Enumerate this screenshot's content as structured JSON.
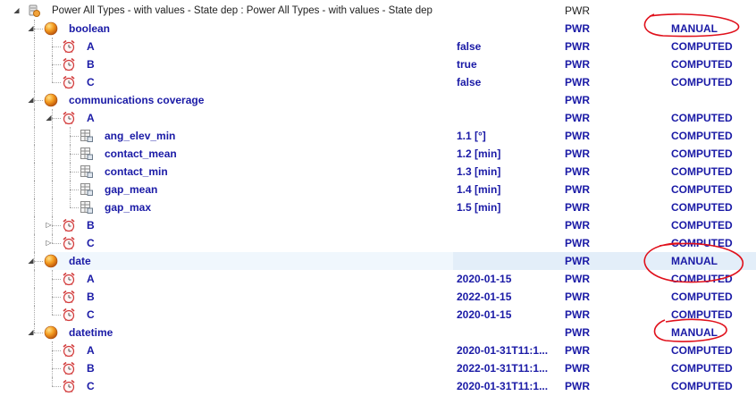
{
  "colors": {
    "text_blue": "#1a1aa6",
    "annotation_red": "#e0101b",
    "selected_row": "#f0f7fd"
  },
  "icons": {
    "root": "database-icon",
    "group": "orange-ball-icon",
    "item": "alarm-clock-icon",
    "parameter": "table-icon"
  },
  "rows": [
    {
      "depth": 0,
      "type": "root",
      "label": "Power All Types - with values - State dep : Power All Types - with values - State dep",
      "value": "",
      "pwr": "PWR",
      "status": "",
      "expander": "expanded"
    },
    {
      "depth": 1,
      "type": "group",
      "label": "boolean",
      "value": "",
      "pwr": "PWR",
      "status": "MANUAL",
      "expander": "expanded"
    },
    {
      "depth": 2,
      "type": "item",
      "label": "A",
      "value": "false",
      "pwr": "PWR",
      "status": "COMPUTED",
      "expander": "none"
    },
    {
      "depth": 2,
      "type": "item",
      "label": "B",
      "value": "true",
      "pwr": "PWR",
      "status": "COMPUTED",
      "expander": "none"
    },
    {
      "depth": 2,
      "type": "item",
      "label": "C",
      "value": "false",
      "pwr": "PWR",
      "status": "COMPUTED",
      "expander": "none"
    },
    {
      "depth": 1,
      "type": "group",
      "label": "communications coverage",
      "value": "",
      "pwr": "PWR",
      "status": "",
      "expander": "expanded"
    },
    {
      "depth": 2,
      "type": "item",
      "label": "A",
      "value": "",
      "pwr": "PWR",
      "status": "COMPUTED",
      "expander": "expanded"
    },
    {
      "depth": 3,
      "type": "parameter",
      "label": "ang_elev_min",
      "value": "1.1 [°]",
      "pwr": "PWR",
      "status": "COMPUTED",
      "expander": "none"
    },
    {
      "depth": 3,
      "type": "parameter",
      "label": "contact_mean",
      "value": "1.2 [min]",
      "pwr": "PWR",
      "status": "COMPUTED",
      "expander": "none"
    },
    {
      "depth": 3,
      "type": "parameter",
      "label": "contact_min",
      "value": "1.3 [min]",
      "pwr": "PWR",
      "status": "COMPUTED",
      "expander": "none"
    },
    {
      "depth": 3,
      "type": "parameter",
      "label": "gap_mean",
      "value": "1.4 [min]",
      "pwr": "PWR",
      "status": "COMPUTED",
      "expander": "none"
    },
    {
      "depth": 3,
      "type": "parameter",
      "label": "gap_max",
      "value": "1.5 [min]",
      "pwr": "PWR",
      "status": "COMPUTED",
      "expander": "none"
    },
    {
      "depth": 2,
      "type": "item",
      "label": "B",
      "value": "",
      "pwr": "PWR",
      "status": "COMPUTED",
      "expander": "collapsed"
    },
    {
      "depth": 2,
      "type": "item",
      "label": "C",
      "value": "",
      "pwr": "PWR",
      "status": "COMPUTED",
      "expander": "collapsed"
    },
    {
      "depth": 1,
      "type": "group",
      "label": "date",
      "value": "",
      "pwr": "PWR",
      "status": "MANUAL",
      "expander": "expanded",
      "selected": true
    },
    {
      "depth": 2,
      "type": "item",
      "label": "A",
      "value": "2020-01-15",
      "pwr": "PWR",
      "status": "COMPUTED",
      "expander": "none"
    },
    {
      "depth": 2,
      "type": "item",
      "label": "B",
      "value": "2022-01-15",
      "pwr": "PWR",
      "status": "COMPUTED",
      "expander": "none"
    },
    {
      "depth": 2,
      "type": "item",
      "label": "C",
      "value": "2020-01-15",
      "pwr": "PWR",
      "status": "COMPUTED",
      "expander": "none"
    },
    {
      "depth": 1,
      "type": "group",
      "label": "datetime",
      "value": "",
      "pwr": "PWR",
      "status": "MANUAL",
      "expander": "expanded"
    },
    {
      "depth": 2,
      "type": "item",
      "label": "A",
      "value": "2020-01-31T11:1...",
      "pwr": "PWR",
      "status": "COMPUTED",
      "expander": "none"
    },
    {
      "depth": 2,
      "type": "item",
      "label": "B",
      "value": "2022-01-31T11:1...",
      "pwr": "PWR",
      "status": "COMPUTED",
      "expander": "none"
    },
    {
      "depth": 2,
      "type": "item",
      "label": "C",
      "value": "2020-01-31T11:1...",
      "pwr": "PWR",
      "status": "COMPUTED",
      "expander": "none"
    }
  ]
}
